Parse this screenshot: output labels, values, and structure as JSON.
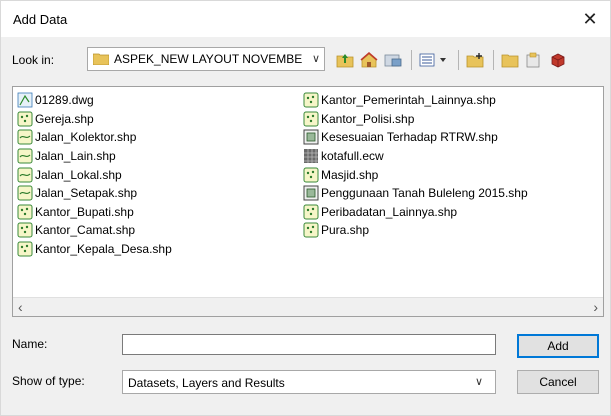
{
  "window": {
    "title": "Add Data"
  },
  "lookin": {
    "label": "Look in:",
    "value": "ASPEK_NEW LAYOUT NOVEMBE"
  },
  "toolbar": {
    "icons": [
      "up-folder-icon",
      "home-icon",
      "connect-folder-icon",
      "view-list-icon",
      "new-folder-icon",
      "folder-icon",
      "catalog-icon",
      "database-icon"
    ]
  },
  "files": {
    "left": [
      {
        "name": "01289.dwg",
        "icon": "cad-icon"
      },
      {
        "name": "Gereja.shp",
        "icon": "point-shp-icon"
      },
      {
        "name": "Jalan_Kolektor.shp",
        "icon": "line-shp-icon"
      },
      {
        "name": "Jalan_Lain.shp",
        "icon": "line-shp-icon"
      },
      {
        "name": "Jalan_Lokal.shp",
        "icon": "line-shp-icon"
      },
      {
        "name": "Jalan_Setapak.shp",
        "icon": "line-shp-icon"
      },
      {
        "name": "Kantor_Bupati.shp",
        "icon": "point-shp-icon"
      },
      {
        "name": "Kantor_Camat.shp",
        "icon": "point-shp-icon"
      },
      {
        "name": "Kantor_Kepala_Desa.shp",
        "icon": "point-shp-icon"
      }
    ],
    "right": [
      {
        "name": "Kantor_Pemerintah_Lainnya.shp",
        "icon": "point-shp-icon"
      },
      {
        "name": "Kantor_Polisi.shp",
        "icon": "point-shp-icon"
      },
      {
        "name": "Kesesuaian Terhadap RTRW.shp",
        "icon": "polygon-shp-icon"
      },
      {
        "name": "kotafull.ecw",
        "icon": "raster-icon"
      },
      {
        "name": "Masjid.shp",
        "icon": "point-shp-icon"
      },
      {
        "name": "Penggunaan Tanah Buleleng 2015.shp",
        "icon": "polygon-shp-icon"
      },
      {
        "name": "Peribadatan_Lainnya.shp",
        "icon": "point-shp-icon"
      },
      {
        "name": "Pura.shp",
        "icon": "point-shp-icon"
      }
    ]
  },
  "form": {
    "name_label": "Name:",
    "name_value": "",
    "type_label": "Show of type:",
    "type_value": "Datasets, Layers and Results"
  },
  "buttons": {
    "add": "Add",
    "cancel": "Cancel"
  }
}
